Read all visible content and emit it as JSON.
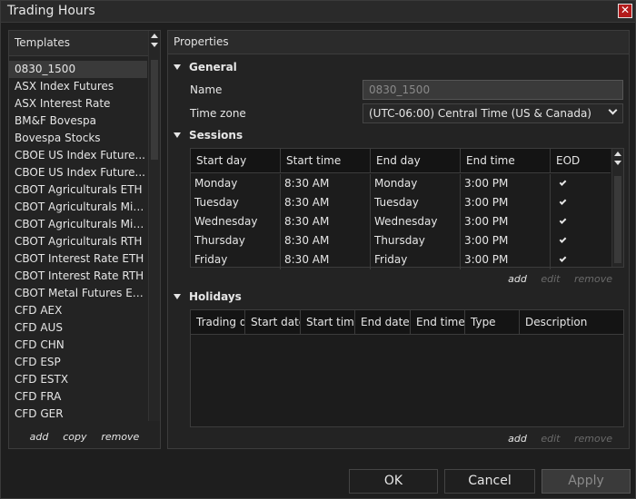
{
  "window": {
    "title": "Trading Hours"
  },
  "templates": {
    "header": "Templates",
    "items": [
      "0830_1500",
      "ASX Index Futures",
      "ASX Interest Rate",
      "BM&F Bovespa",
      "Bovespa Stocks",
      "CBOE US Index Future...",
      "CBOE US Index Future...",
      "CBOT Agriculturals ETH",
      "CBOT Agriculturals Min...",
      "CBOT Agriculturals Min...",
      "CBOT Agriculturals RTH",
      "CBOT Interest Rate ETH",
      "CBOT Interest Rate RTH",
      "CBOT Metal Futures ETH",
      "CFD AEX",
      "CFD AUS",
      "CFD CHN",
      "CFD ESP",
      "CFD ESTX",
      "CFD FRA",
      "CFD GER"
    ],
    "selected_index": 0,
    "actions": {
      "add": "add",
      "copy": "copy",
      "remove": "remove"
    }
  },
  "properties": {
    "header": "Properties",
    "general": {
      "label": "General",
      "name_label": "Name",
      "name_value": "0830_1500",
      "timezone_label": "Time zone",
      "timezone_value": "(UTC-06:00) Central Time (US & Canada)"
    },
    "sessions": {
      "label": "Sessions",
      "columns": [
        "Start day",
        "Start time",
        "End day",
        "End time",
        "EOD"
      ],
      "rows": [
        [
          "Monday",
          "8:30 AM",
          "Monday",
          "3:00 PM",
          true
        ],
        [
          "Tuesday",
          "8:30 AM",
          "Tuesday",
          "3:00 PM",
          true
        ],
        [
          "Wednesday",
          "8:30 AM",
          "Wednesday",
          "3:00 PM",
          true
        ],
        [
          "Thursday",
          "8:30 AM",
          "Thursday",
          "3:00 PM",
          true
        ],
        [
          "Friday",
          "8:30 AM",
          "Friday",
          "3:00 PM",
          true
        ]
      ],
      "actions": {
        "add": "add",
        "edit": "edit",
        "remove": "remove"
      }
    },
    "holidays": {
      "label": "Holidays",
      "columns": [
        "Trading d",
        "Start date",
        "Start time",
        "End date",
        "End time",
        "Type",
        "Description"
      ],
      "actions": {
        "add": "add",
        "edit": "edit",
        "remove": "remove"
      }
    }
  },
  "buttons": {
    "ok": "OK",
    "cancel": "Cancel",
    "apply": "Apply"
  }
}
